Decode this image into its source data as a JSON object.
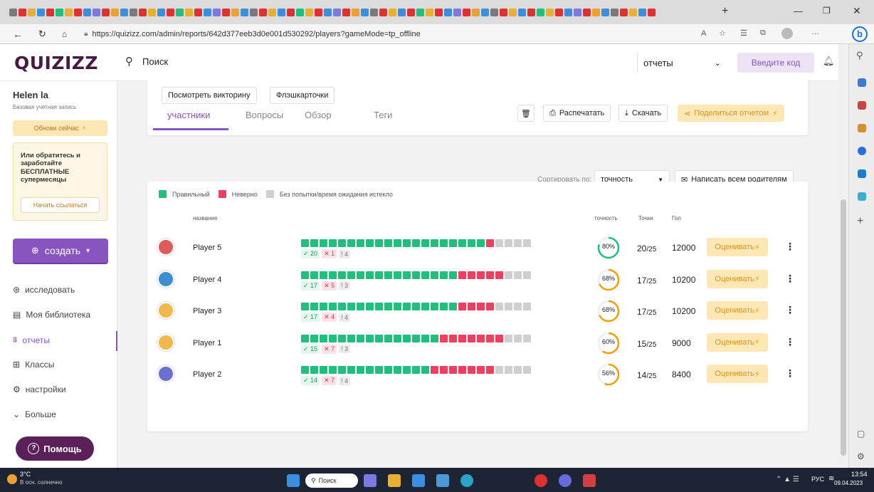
{
  "browser": {
    "url": "https://quizizz.com/admin/reports/642d377eeb3d0e001d530292/players?gameMode=tp_offline",
    "tab_add": "+"
  },
  "header": {
    "logo": "QUIZIZZ",
    "search_placeholder": "Поиск",
    "scope_select": "отчеты",
    "join_button": "Введите код"
  },
  "sidebar": {
    "user_name": "Helen la",
    "account_type": "Базовая учетная запись",
    "upgrade_button": "Обнови сейчас",
    "promo_text": "Или обратитесь и заработайте БЕСПЛАТНЫЕ супермесяцы",
    "promo_button": "Начать ссылаться",
    "create_button": "создать",
    "nav": [
      {
        "label": "исследовать",
        "icon": "compass-icon",
        "active": false
      },
      {
        "label": "Моя библиотека",
        "icon": "library-icon",
        "active": false
      },
      {
        "label": "отчеты",
        "icon": "reports-icon",
        "active": true
      },
      {
        "label": "Классы",
        "icon": "classes-icon",
        "active": false
      },
      {
        "label": "настройки",
        "icon": "settings-icon",
        "active": false
      },
      {
        "label": "Больше",
        "icon": "chevron-down-icon",
        "active": false
      }
    ],
    "help_button": "Помощь"
  },
  "report": {
    "top_buttons": [
      "Посмотреть викторину",
      "Флэшкарточки"
    ],
    "tabs": [
      "участники",
      "Вопросы",
      "Обзор",
      "Теги"
    ],
    "active_tab": 0,
    "actions": {
      "print": "Распечатать",
      "download": "Скачать",
      "share": "Поделиться отчетом"
    },
    "sort_label": "Сортировать по:",
    "sort_value": "точность",
    "email_parents": "Написать всем родителям",
    "legend": {
      "correct": "Правильный",
      "wrong": "Неверно",
      "unattempted": "Без попытки/время ожидания истекло"
    },
    "columns": {
      "name": "название",
      "accuracy": "точность",
      "points": "Точки",
      "score": "Гол"
    },
    "grade_button": "Оценивать",
    "players": [
      {
        "name": "Player 5",
        "accuracy": "80%",
        "acc_value": 0.8,
        "points": "20",
        "total": "/25",
        "score": "12000",
        "correct": 20,
        "wrong": 1,
        "skip": 4,
        "c_txt": "20",
        "w_txt": "1",
        "s_txt": "4",
        "avatar_color": "#e05a5a"
      },
      {
        "name": "Player 4",
        "accuracy": "68%",
        "acc_value": 0.68,
        "points": "17",
        "total": "/25",
        "score": "10200",
        "correct": 17,
        "wrong": 5,
        "skip": 3,
        "c_txt": "17",
        "w_txt": "5",
        "s_txt": "3",
        "avatar_color": "#3a8fd0"
      },
      {
        "name": "Player 3",
        "accuracy": "68%",
        "acc_value": 0.68,
        "points": "17",
        "total": "/25",
        "score": "10200",
        "correct": 17,
        "wrong": 4,
        "skip": 4,
        "c_txt": "17",
        "w_txt": "4",
        "s_txt": "4",
        "avatar_color": "#f0b94a"
      },
      {
        "name": "Player 1",
        "accuracy": "60%",
        "acc_value": 0.6,
        "points": "15",
        "total": "/25",
        "score": "9000",
        "correct": 15,
        "wrong": 7,
        "skip": 3,
        "c_txt": "15",
        "w_txt": "7",
        "s_txt": "3",
        "avatar_color": "#f0b94a"
      },
      {
        "name": "Player 2",
        "accuracy": "56%",
        "acc_value": 0.56,
        "points": "14",
        "total": "/25",
        "score": "8400",
        "correct": 14,
        "wrong": 7,
        "skip": 4,
        "c_txt": "14",
        "w_txt": "7",
        "s_txt": "4",
        "avatar_color": "#6a6fd0"
      }
    ]
  },
  "colors": {
    "correct": "#1fc07d",
    "wrong": "#ef3e5e",
    "skip": "#cfcfcf",
    "brand": "#8854c0",
    "ring": "#f0a000",
    "ring_good": "#1fc07d"
  },
  "taskbar": {
    "weather_temp": "3°C",
    "weather_desc": "В осн. солнечно",
    "search": "Поиск",
    "lang": "РУС",
    "time": "13:54",
    "date": "09.04.2023"
  }
}
